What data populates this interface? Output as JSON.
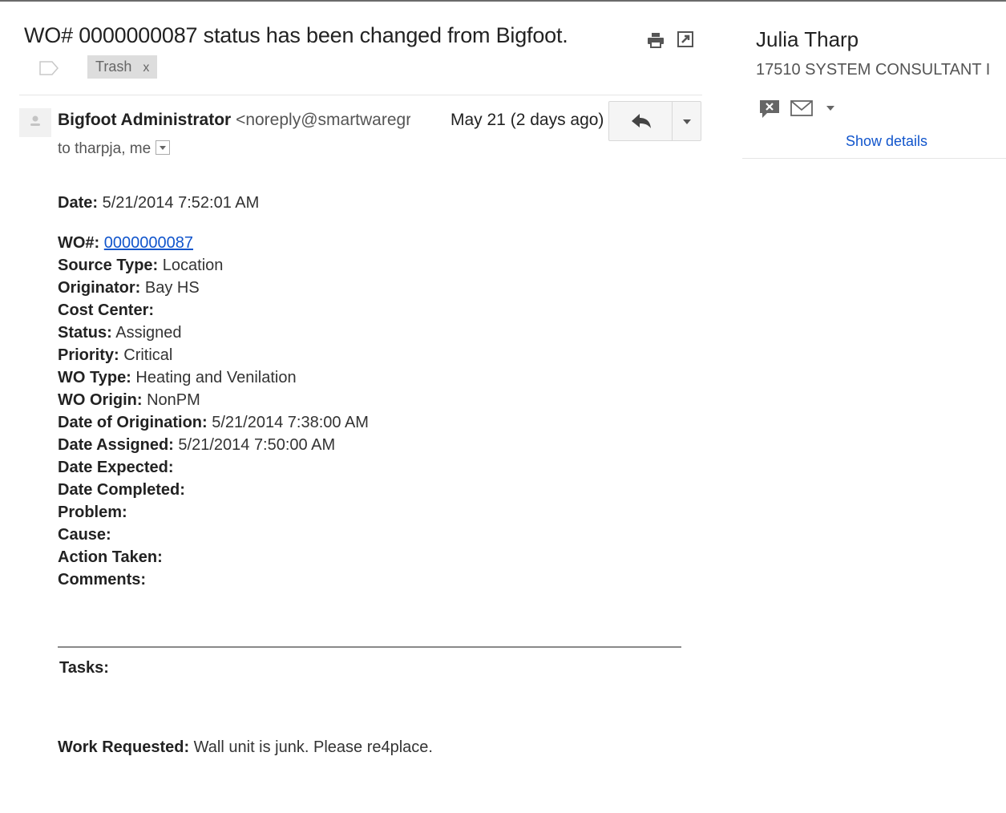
{
  "message": {
    "subject": "WO# 0000000087 status has been changed from Bigfoot.",
    "labels": [
      {
        "name": "Trash",
        "remove": "x"
      }
    ],
    "sender_name": "Bigfoot Administrator",
    "sender_email": "<noreply@smartwaregrc",
    "date": "May 21 (2 days ago)",
    "recipients": "to tharpja, me"
  },
  "body": {
    "date_label": "Date:",
    "date_value": "5/21/2014 7:52:01 AM",
    "fields": [
      {
        "label": "WO#:",
        "value": "0000000087",
        "link": true
      },
      {
        "label": "Source Type:",
        "value": "Location"
      },
      {
        "label": "Originator:",
        "value": "Bay HS"
      },
      {
        "label": "Cost Center:",
        "value": ""
      },
      {
        "label": "Status:",
        "value": "Assigned"
      },
      {
        "label": "Priority:",
        "value": "Critical"
      },
      {
        "label": "WO Type:",
        "value": "Heating and Venilation"
      },
      {
        "label": "WO Origin:",
        "value": "NonPM"
      },
      {
        "label": "Date of Origination:",
        "value": "5/21/2014 7:38:00 AM"
      },
      {
        "label": "Date Assigned:",
        "value": "5/21/2014 7:50:00 AM"
      },
      {
        "label": "Date Expected:",
        "value": ""
      },
      {
        "label": "Date Completed:",
        "value": ""
      },
      {
        "label": "Problem:",
        "value": ""
      },
      {
        "label": "Cause:",
        "value": ""
      },
      {
        "label": "Action Taken:",
        "value": ""
      },
      {
        "label": "Comments:",
        "value": ""
      }
    ],
    "tasks_label": "Tasks:",
    "work_label": "Work Requested:",
    "work_value": "Wall unit is junk. Please re4place."
  },
  "contact": {
    "name": "Julia Tharp",
    "title": "17510 SYSTEM CONSULTANT I",
    "show_details": "Show details"
  },
  "colors": {
    "link": "#1155cc",
    "label_bg": "#dddddd",
    "button_bg": "#f5f5f5"
  },
  "icons": [
    "print-icon",
    "new-window-icon",
    "label-tag-icon",
    "reply-icon",
    "chevron-down-icon",
    "chat-icon",
    "mail-icon"
  ]
}
